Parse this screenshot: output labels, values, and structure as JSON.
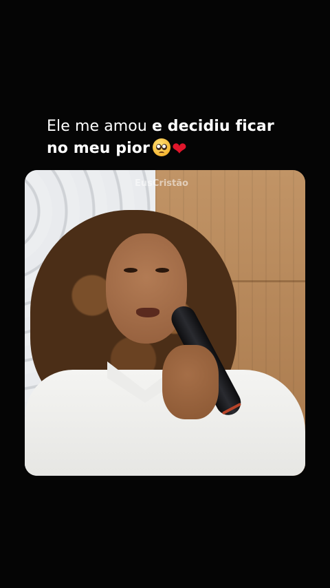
{
  "caption": {
    "part1": "Ele me amou ",
    "part2": "e decidiu ficar",
    "part3": "no meu pior",
    "emoji1": "pleading-face-emoji",
    "emoji2": "❤"
  },
  "video": {
    "watermark": "EusCristão"
  },
  "colors": {
    "background": "#050505",
    "text": "#ffffff",
    "heart": "#e0162b"
  }
}
